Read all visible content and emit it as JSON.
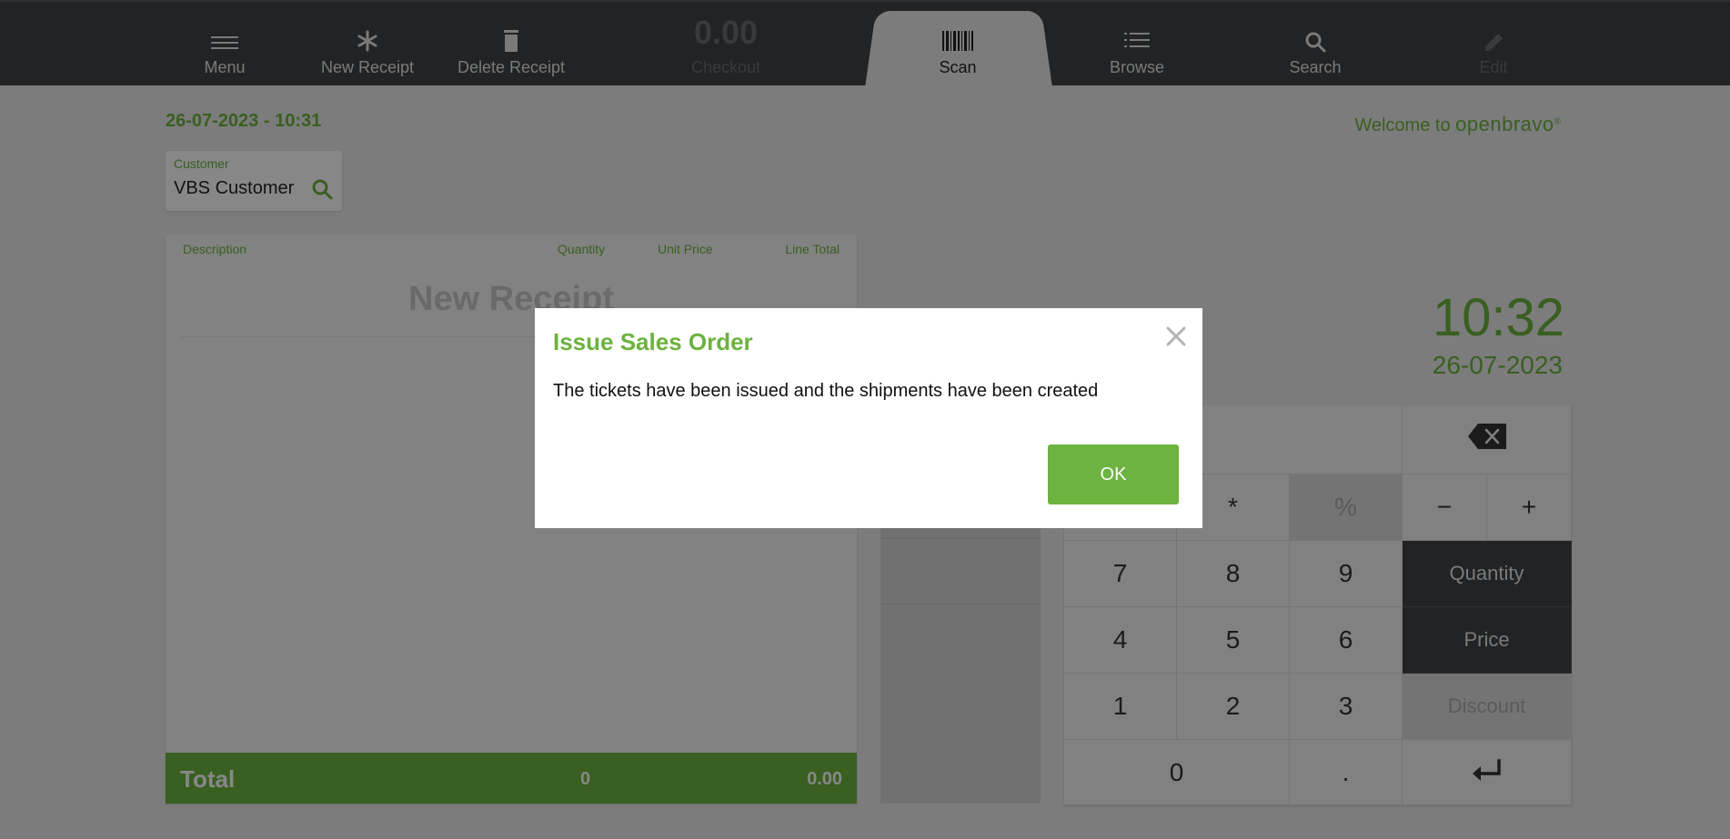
{
  "toolbar": {
    "menu_label": "Menu",
    "new_receipt_label": "New Receipt",
    "delete_receipt_label": "Delete Receipt",
    "checkout_amount": "0.00",
    "checkout_label": "Checkout",
    "scan_label": "Scan",
    "browse_label": "Browse",
    "search_label": "Search",
    "edit_label": "Edit"
  },
  "header": {
    "datetime": "26-07-2023 - 10:31",
    "welcome_text": "Welcome to",
    "brand": "openbravo",
    "brand_mark": "®"
  },
  "customer": {
    "caption": "Customer",
    "value": "VBS Customer"
  },
  "receipt": {
    "col_description": "Description",
    "col_quantity": "Quantity",
    "col_unit_price": "Unit Price",
    "col_line_total": "Line Total",
    "title": "New Receipt",
    "total_label": "Total",
    "total_qty": "0",
    "total_amount": "0.00"
  },
  "clock": {
    "time": "10:32",
    "date": "26-07-2023"
  },
  "keypad": {
    "star": "*",
    "percent": "%",
    "minus": "−",
    "plus": "+",
    "k7": "7",
    "k8": "8",
    "k9": "9",
    "k4": "4",
    "k5": "5",
    "k6": "6",
    "k1": "1",
    "k2": "2",
    "k3": "3",
    "k0": "0",
    "dot": ".",
    "quantity_label": "Quantity",
    "price_label": "Price",
    "discount_label": "Discount"
  },
  "dialog": {
    "title": "Issue Sales Order",
    "message": "The tickets have been issued and the shipments have been created",
    "ok_label": "OK"
  },
  "colors": {
    "accent": "#6cb33f",
    "toolbar": "#3f4246"
  }
}
